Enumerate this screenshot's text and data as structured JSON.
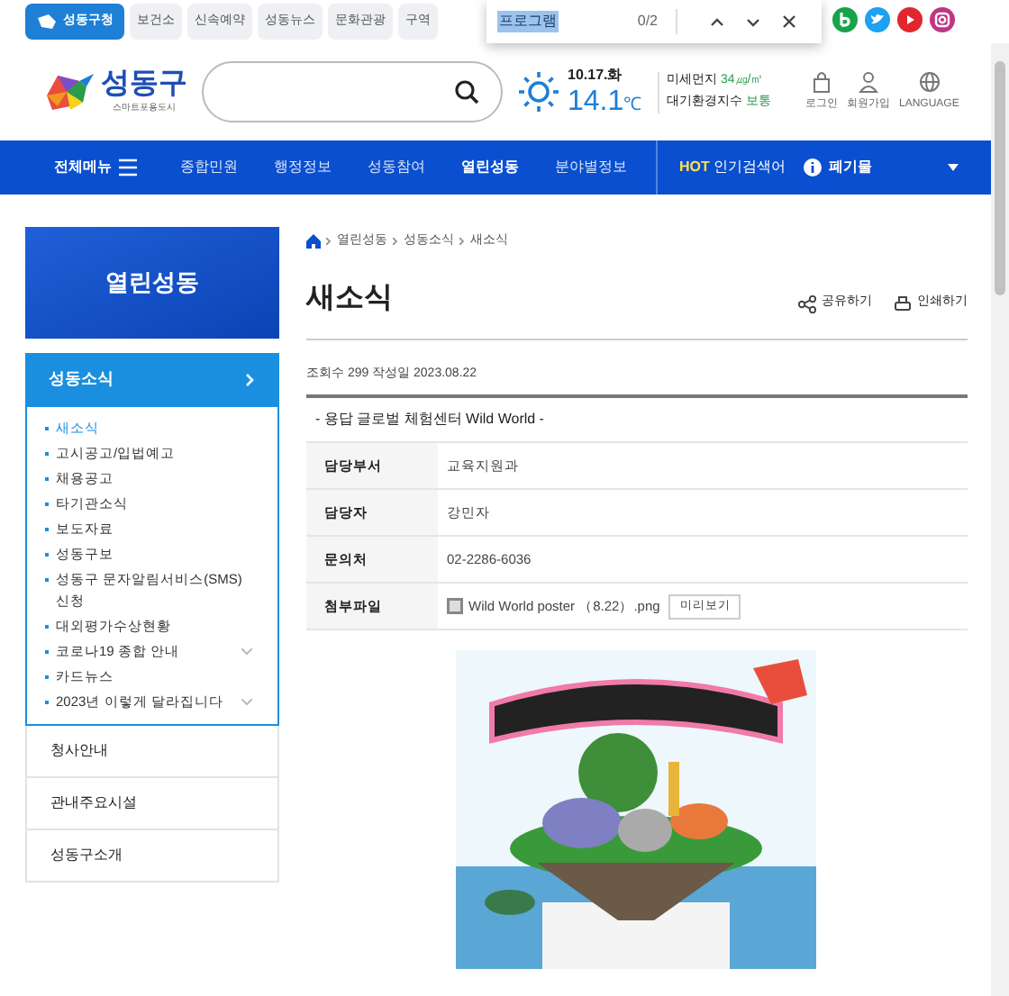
{
  "top_tabs": [
    {
      "label": "성동구청",
      "selected": true
    },
    {
      "label": "보건소",
      "selected": false
    },
    {
      "label": "신속예약",
      "selected": false
    },
    {
      "label": "성동뉴스",
      "selected": false
    },
    {
      "label": "문화관광",
      "selected": false
    },
    {
      "label": "구역",
      "selected": false
    }
  ],
  "find_bar": {
    "value": "프로그램",
    "count": "0/2"
  },
  "logo": {
    "name": "성동구",
    "tagline": "스마트포용도시"
  },
  "weather": {
    "date": "10.17.화",
    "temp": "14.1",
    "unit": "℃",
    "dust_label": "미세먼지",
    "dust_value": "34㎍/㎥",
    "air_label": "대기환경지수",
    "air_value": "보통"
  },
  "user_links": [
    {
      "kind": "lock",
      "label": "로그인"
    },
    {
      "kind": "person",
      "label": "회원가입"
    },
    {
      "kind": "globe",
      "label": "LANGUAGE"
    }
  ],
  "nav": {
    "all_menu": "전체메뉴",
    "items": [
      {
        "label": "종합민원",
        "selected": false
      },
      {
        "label": "행정정보",
        "selected": false
      },
      {
        "label": "성동참여",
        "selected": false
      },
      {
        "label": "열린성동",
        "selected": true
      },
      {
        "label": "분야별정보",
        "selected": false
      }
    ],
    "hot_tag": "HOT",
    "hot_label": "인기검색어",
    "hot_keyword": "폐기물"
  },
  "sidebar": {
    "title": "열린성동",
    "section": {
      "label": "성동소식",
      "expanded": true,
      "items": [
        {
          "label": "새소식",
          "selected": true,
          "has_sub": false
        },
        {
          "label": "고시공고/입법예고",
          "selected": false,
          "has_sub": false
        },
        {
          "label": "채용공고",
          "selected": false,
          "has_sub": false
        },
        {
          "label": "타기관소식",
          "selected": false,
          "has_sub": false
        },
        {
          "label": "보도자료",
          "selected": false,
          "has_sub": false
        },
        {
          "label": "성동구보",
          "selected": false,
          "has_sub": false
        },
        {
          "label": "성동구 문자알림서비스(SMS) 신청",
          "selected": false,
          "has_sub": false
        },
        {
          "label": "대외평가수상현황",
          "selected": false,
          "has_sub": false
        },
        {
          "label": "코로나19 종합 안내",
          "selected": false,
          "has_sub": true
        },
        {
          "label": "카드뉴스",
          "selected": false,
          "has_sub": false
        },
        {
          "label": "2023년 이렇게 달라집니다",
          "selected": false,
          "has_sub": true
        }
      ]
    },
    "others": [
      "청사안내",
      "관내주요시설",
      "성동구소개"
    ]
  },
  "breadcrumb": [
    "열린성동",
    "성동소식",
    "새소식"
  ],
  "page_title": "새소식",
  "actions": [
    {
      "kind": "share",
      "label": "공유하기"
    },
    {
      "kind": "print",
      "label": "인쇄하기"
    }
  ],
  "meta": "조회수 299 작성일 2023.08.22",
  "post_title": "- 용답 글로벌 체험센터 Wild World -",
  "details": [
    {
      "label": "담당부서",
      "value": "교육지원과"
    },
    {
      "label": "담당자",
      "value": "강민자"
    },
    {
      "label": "문의처",
      "value": "02-2286-6036"
    },
    {
      "label": "첨부파일",
      "value": "Wild World poster （8.22）.png",
      "button": "미리보기"
    }
  ],
  "poster": {
    "kind": "picture"
  }
}
